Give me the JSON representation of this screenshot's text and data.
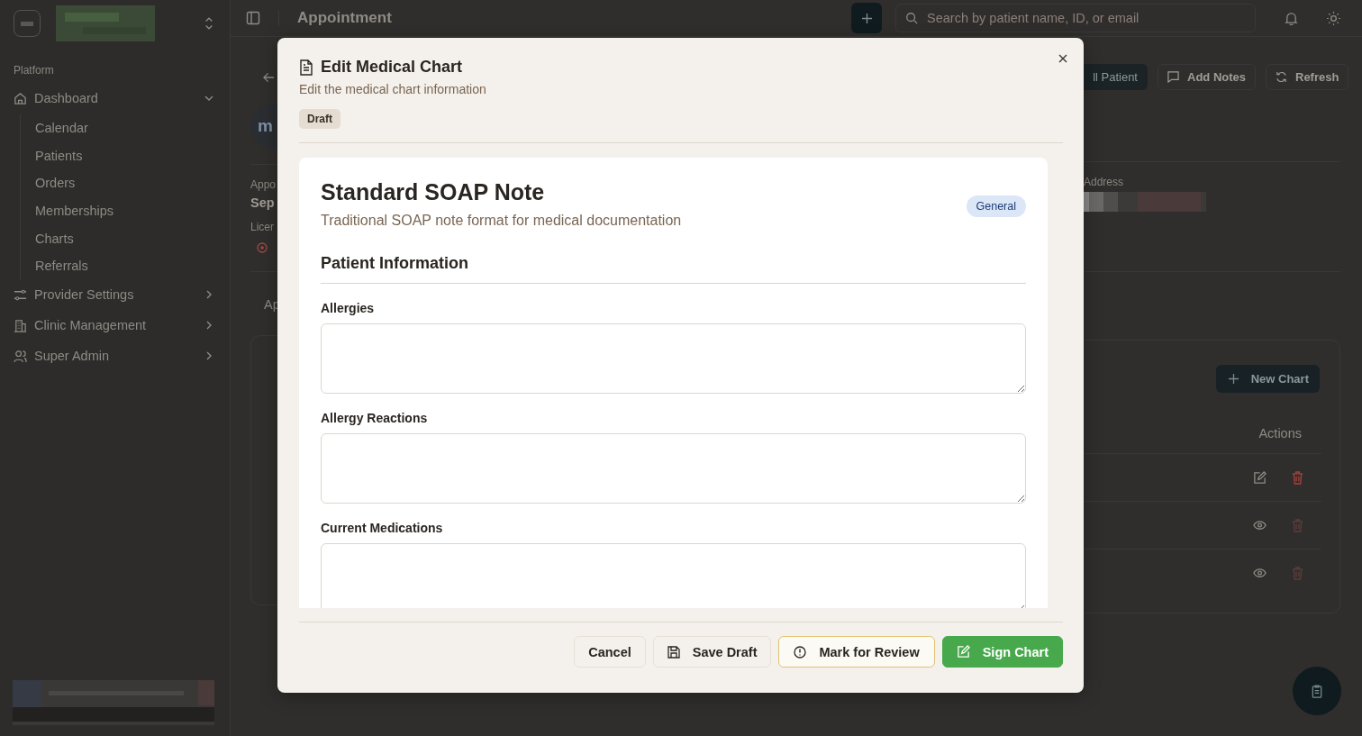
{
  "sidebar": {
    "section_label": "Platform",
    "items": [
      {
        "label": "Dashboard",
        "expanded": true,
        "children": [
          {
            "label": "Calendar"
          },
          {
            "label": "Patients"
          },
          {
            "label": "Orders"
          },
          {
            "label": "Memberships"
          },
          {
            "label": "Charts"
          },
          {
            "label": "Referrals"
          }
        ]
      },
      {
        "label": "Provider Settings",
        "expanded": false
      },
      {
        "label": "Clinic Management",
        "expanded": false
      },
      {
        "label": "Super Admin",
        "expanded": false
      }
    ]
  },
  "topbar": {
    "title": "Appointment",
    "search": {
      "placeholder": "Search by patient name, ID, or email"
    }
  },
  "page": {
    "avatar": "m",
    "field_1_label": "Appo",
    "field_1_value": "Sep",
    "field_2_label": "Licer",
    "tab": "Ap",
    "buttons": [
      "ll Patient",
      "Add Notes",
      "Refresh"
    ],
    "address_label": "Address",
    "new_chart": "New Chart",
    "actions_header": "Actions",
    "rows": [
      {
        "kind": "edit",
        "delete_disabled": false
      },
      {
        "kind": "view",
        "delete_disabled": true
      },
      {
        "kind": "view",
        "delete_disabled": true
      }
    ]
  },
  "modal": {
    "title": "Edit Medical Chart",
    "subtitle": "Edit the medical chart information",
    "status": "Draft",
    "template": {
      "title": "Standard SOAP Note",
      "description": "Traditional SOAP note format for medical documentation",
      "category": "General",
      "section": "Patient Information",
      "fields": [
        {
          "label": "Allergies"
        },
        {
          "label": "Allergy Reactions"
        },
        {
          "label": "Current Medications"
        }
      ]
    },
    "buttons": [
      {
        "kind": "cancel",
        "label": "Cancel"
      },
      {
        "kind": "save",
        "label": "Save Draft"
      },
      {
        "kind": "review",
        "label": "Mark for Review"
      },
      {
        "kind": "sign",
        "label": "Sign Chart"
      }
    ]
  }
}
